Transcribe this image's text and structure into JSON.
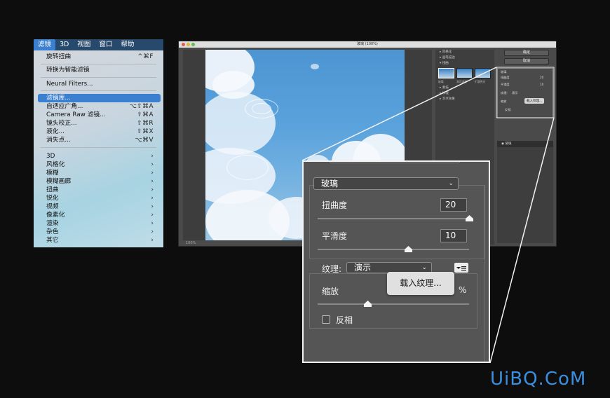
{
  "menubar": {
    "items": [
      "滤镜",
      "3D",
      "视图",
      "窗口",
      "帮助"
    ],
    "active_index": 0
  },
  "filter_menu": {
    "items": [
      {
        "label": "旋转扭曲",
        "shortcut": "^⌘F"
      },
      {
        "label": "转换为智能滤镜",
        "shortcut": ""
      },
      {
        "label": "Neural Filters...",
        "shortcut": ""
      },
      {
        "label": "滤镜库...",
        "shortcut": ""
      },
      {
        "label": "自适应广角...",
        "shortcut": "⌥⇧⌘A"
      },
      {
        "label": "Camera Raw 滤镜...",
        "shortcut": "⇧⌘A"
      },
      {
        "label": "镜头校正...",
        "shortcut": "⇧⌘R"
      },
      {
        "label": "液化...",
        "shortcut": "⇧⌘X"
      },
      {
        "label": "消失点...",
        "shortcut": "⌥⌘V"
      }
    ],
    "submenus": [
      "3D",
      "风格化",
      "模糊",
      "模糊画廊",
      "扭曲",
      "锐化",
      "视频",
      "像素化",
      "渲染",
      "杂色",
      "其它"
    ],
    "highlighted": "滤镜库..."
  },
  "gallery_window": {
    "title": "玻璃 (100%)",
    "zoom": "100%",
    "ok_label": "确定",
    "cancel_label": "取消",
    "tree": [
      "风格化",
      "画笔描边",
      "扭曲",
      "素描",
      "纹理",
      "艺术效果"
    ],
    "thumbs": [
      "玻璃",
      "海洋波纹",
      "扩散亮光"
    ],
    "mini_rows": [
      "玻璃",
      "扭曲度",
      "平滑度",
      "纹理:",
      "演示",
      "缩放",
      "反相"
    ],
    "mini_tooltip": "载入纹理...",
    "mini_values": [
      "20",
      "10"
    ],
    "layer_name": "玻璃"
  },
  "settings_panel": {
    "filter_name": "玻璃",
    "distortion": {
      "label": "扭曲度",
      "value": "20",
      "fraction": 1.0
    },
    "smoothness": {
      "label": "平滑度",
      "value": "10",
      "fraction": 0.6
    },
    "texture": {
      "label": "纹理:",
      "value": "演示"
    },
    "tooltip": "载入纹理...",
    "scale": {
      "label": "缩放",
      "unit": "%",
      "fraction": 0.33
    },
    "invert": {
      "label": "反相",
      "checked": false
    }
  },
  "watermark": "UiBQ.CoM",
  "colors": {
    "accent": "#3a7fd0",
    "watermark": "#3b8fe0",
    "panel_bg": "#555556"
  }
}
